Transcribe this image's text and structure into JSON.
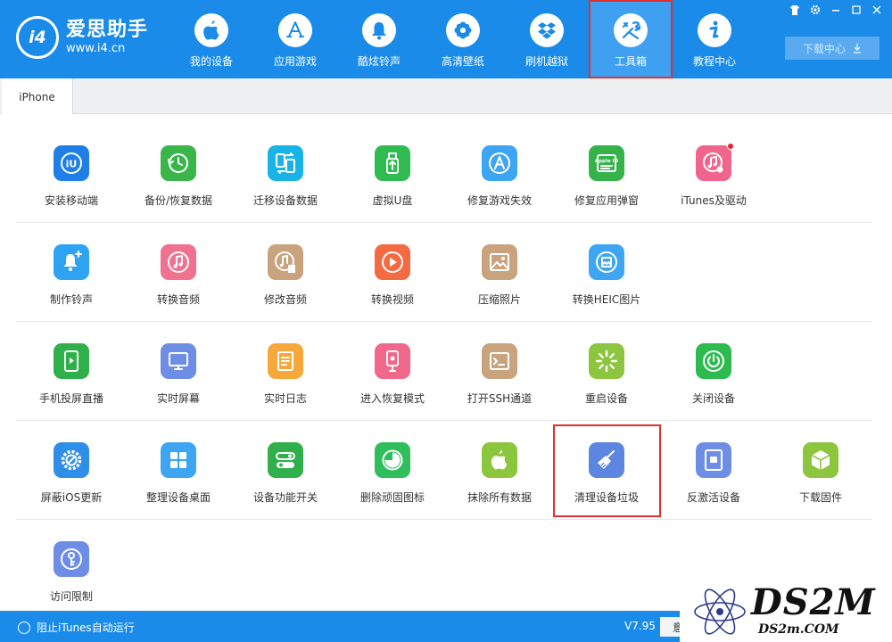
{
  "app": {
    "logo_title": "爱思助手",
    "logo_url": "www.i4.cn",
    "logo_badge": "i4"
  },
  "nav": [
    {
      "label": "我的设备",
      "icon": "apple-icon"
    },
    {
      "label": "应用游戏",
      "icon": "app-store-icon"
    },
    {
      "label": "酷炫铃声",
      "icon": "bell-icon"
    },
    {
      "label": "高清壁纸",
      "icon": "flower-icon"
    },
    {
      "label": "刷机越狱",
      "icon": "dropbox-icon"
    },
    {
      "label": "工具箱",
      "icon": "tools-icon",
      "active": true
    },
    {
      "label": "教程中心",
      "icon": "info-icon"
    }
  ],
  "window": {
    "controls": [
      "skin-icon",
      "settings-icon",
      "minimize-icon",
      "maximize-icon",
      "close-icon"
    ],
    "download_label": "下载中心"
  },
  "tabs": [
    {
      "label": "iPhone",
      "active": true
    }
  ],
  "tools": [
    [
      {
        "label": "安装移动端",
        "icon": "i4-icon",
        "color": "#1f7fe6"
      },
      {
        "label": "备份/恢复数据",
        "icon": "clock-back-icon",
        "color": "#39b54a"
      },
      {
        "label": "迁移设备数据",
        "icon": "phone-transfer-icon",
        "color": "#18b4e8"
      },
      {
        "label": "虚拟U盘",
        "icon": "usb-icon",
        "color": "#2fbb4f"
      },
      {
        "label": "修复游戏失效",
        "icon": "app-store-icon",
        "color": "#3ea5f2"
      },
      {
        "label": "修复应用弹窗",
        "icon": "apple-id-icon",
        "color": "#36b24a"
      },
      {
        "label": "iTunes及驱动",
        "icon": "music-gear-icon",
        "color": "#f0658e",
        "badge": true
      }
    ],
    [
      {
        "label": "制作铃声",
        "icon": "bell-plus-icon",
        "color": "#2ea3f2"
      },
      {
        "label": "转换音频",
        "icon": "music-icon",
        "color": "#f07290"
      },
      {
        "label": "修改音频",
        "icon": "music-edit-icon",
        "color": "#c9a37e"
      },
      {
        "label": "转换视频",
        "icon": "play-icon",
        "color": "#f46b43"
      },
      {
        "label": "压缩照片",
        "icon": "image-icon",
        "color": "#c9a37e"
      },
      {
        "label": "转换HEIC图片",
        "icon": "heic-icon",
        "color": "#3ea5f2"
      }
    ],
    [
      {
        "label": "手机投屏直播",
        "icon": "screen-cast-icon",
        "color": "#2fb04a"
      },
      {
        "label": "实时屏幕",
        "icon": "monitor-icon",
        "color": "#6e8ee6"
      },
      {
        "label": "实时日志",
        "icon": "log-icon",
        "color": "#f6a93a"
      },
      {
        "label": "进入恢复模式",
        "icon": "recovery-icon",
        "color": "#f2678c"
      },
      {
        "label": "打开SSH通道",
        "icon": "terminal-icon",
        "color": "#c9a37e"
      },
      {
        "label": "重启设备",
        "icon": "restart-icon",
        "color": "#8cc63f"
      },
      {
        "label": "关闭设备",
        "icon": "power-icon",
        "color": "#2dbb4f"
      }
    ],
    [
      {
        "label": "屏蔽iOS更新",
        "icon": "gear-block-icon",
        "color": "#2e8ee8"
      },
      {
        "label": "整理设备桌面",
        "icon": "grid-icon",
        "color": "#3ea5f2"
      },
      {
        "label": "设备功能开关",
        "icon": "toggle-icon",
        "color": "#2fb04a"
      },
      {
        "label": "删除顽固图标",
        "icon": "pie-icon",
        "color": "#30bd5c"
      },
      {
        "label": "抹除所有数据",
        "icon": "apple-erase-icon",
        "color": "#8cc63f"
      },
      {
        "label": "清理设备垃圾",
        "icon": "broom-icon",
        "color": "#5c86e0",
        "highlighted": true
      },
      {
        "label": "反激活设备",
        "icon": "tablet-icon",
        "color": "#6e8ee6"
      },
      {
        "label": "下载固件",
        "icon": "box-icon",
        "color": "#8cc63f"
      }
    ],
    [
      {
        "label": "访问限制",
        "icon": "key-icon",
        "color": "#6e8ee6"
      }
    ]
  ],
  "status": {
    "toggle_label": "阻止iTunes自动运行",
    "version": "V7.95",
    "feedback_label": "意"
  },
  "watermark": {
    "big": "DS2M",
    "small": "DS2m.COM"
  }
}
